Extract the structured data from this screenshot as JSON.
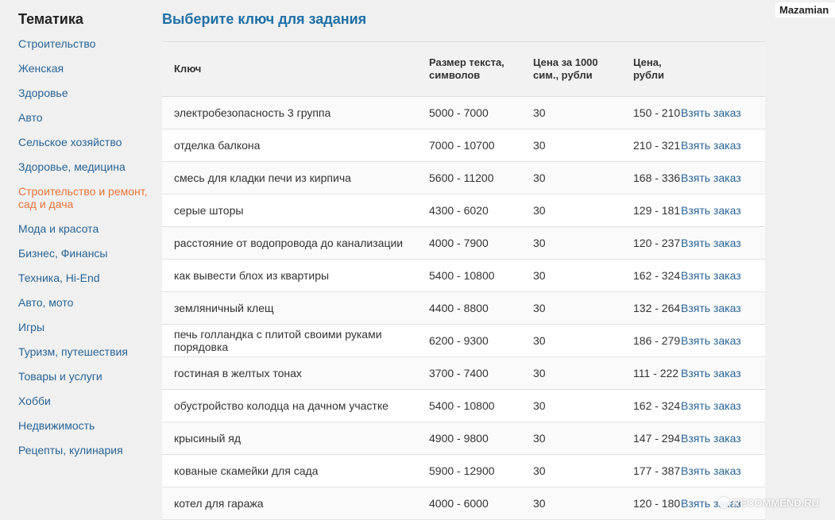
{
  "user": {
    "name": "Mazamian"
  },
  "sidebar": {
    "title": "Тематика",
    "items": [
      {
        "label": "Строительство"
      },
      {
        "label": "Женская"
      },
      {
        "label": "Здоровье"
      },
      {
        "label": "Авто"
      },
      {
        "label": "Сельское хозяйство"
      },
      {
        "label": "Здоровье, медицина"
      },
      {
        "label": "Строительство и ремонт, сад и дача",
        "active": true
      },
      {
        "label": "Мода и красота"
      },
      {
        "label": "Бизнес, Финансы"
      },
      {
        "label": "Техника, Hi-End"
      },
      {
        "label": "Авто, мото"
      },
      {
        "label": "Игры"
      },
      {
        "label": "Туризм, путешествия"
      },
      {
        "label": "Товары и услуги"
      },
      {
        "label": "Хобби"
      },
      {
        "label": "Недвижимость"
      },
      {
        "label": "Рецепты, кулинария"
      }
    ]
  },
  "main": {
    "title": "Выберите ключ для задания",
    "table": {
      "headers": {
        "key": "Ключ",
        "size": "Размер текста, символов",
        "price_per_1000": "Цена за 1000 сим., рубли",
        "price": "Цена, рубли"
      },
      "action_label": "Взять заказ",
      "rows": [
        {
          "key": "электробезопасность 3 группа",
          "size": "5000 - 7000",
          "rate": "30",
          "price": "150 - 210"
        },
        {
          "key": "отделка балкона",
          "size": "7000 - 10700",
          "rate": "30",
          "price": "210 - 321"
        },
        {
          "key": "смесь для кладки печи из кирпича",
          "size": "5600 - 11200",
          "rate": "30",
          "price": "168 - 336"
        },
        {
          "key": "серые шторы",
          "size": "4300 - 6020",
          "rate": "30",
          "price": "129 - 181"
        },
        {
          "key": "расстояние от водопровода до канализации",
          "size": "4000 - 7900",
          "rate": "30",
          "price": "120 - 237"
        },
        {
          "key": "как вывести блох из квартиры",
          "size": "5400 - 10800",
          "rate": "30",
          "price": "162 - 324"
        },
        {
          "key": "земляничный клещ",
          "size": "4400 - 8800",
          "rate": "30",
          "price": "132 - 264"
        },
        {
          "key": "печь голландка с плитой своими руками порядовка",
          "size": "6200 - 9300",
          "rate": "30",
          "price": "186 - 279"
        },
        {
          "key": "гостиная в желтых тонах",
          "size": "3700 - 7400",
          "rate": "30",
          "price": "111 - 222"
        },
        {
          "key": "обустройство колодца на дачном участке",
          "size": "5400 - 10800",
          "rate": "30",
          "price": "162 - 324"
        },
        {
          "key": "крысиный яд",
          "size": "4900 - 9800",
          "rate": "30",
          "price": "147 - 294"
        },
        {
          "key": "кованые скамейки для сада",
          "size": "5900 - 12900",
          "rate": "30",
          "price": "177 - 387"
        },
        {
          "key": "котел для гаража",
          "size": "4000 - 6000",
          "rate": "30",
          "price": "120 - 180"
        }
      ]
    }
  },
  "watermark": {
    "text": "RECOMMEND.RU"
  }
}
